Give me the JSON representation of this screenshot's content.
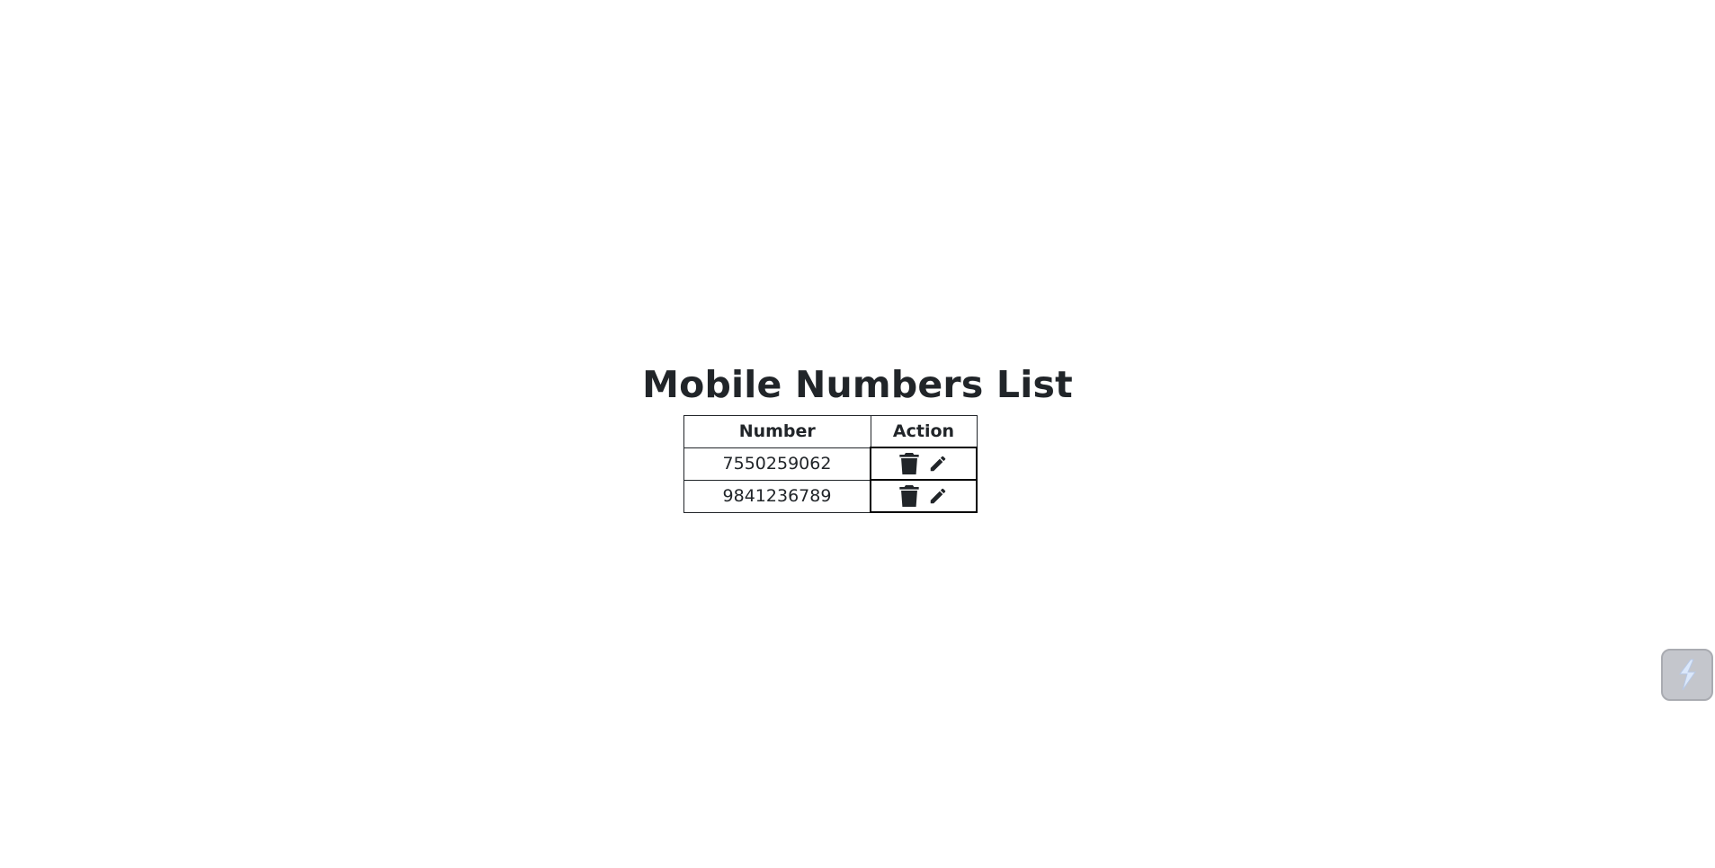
{
  "page": {
    "title": "Mobile Numbers List"
  },
  "table": {
    "headers": {
      "number": "Number",
      "action": "Action"
    },
    "rows": [
      {
        "number": "7550259062"
      },
      {
        "number": "9841236789"
      }
    ]
  },
  "icons": {
    "delete": "trash-icon",
    "edit": "pencil-icon",
    "widget": "lightning-bolt-icon"
  },
  "colors": {
    "text": "#212529",
    "widget_bg": "#c4c6cc",
    "widget_icon": "#dbe8fb"
  }
}
